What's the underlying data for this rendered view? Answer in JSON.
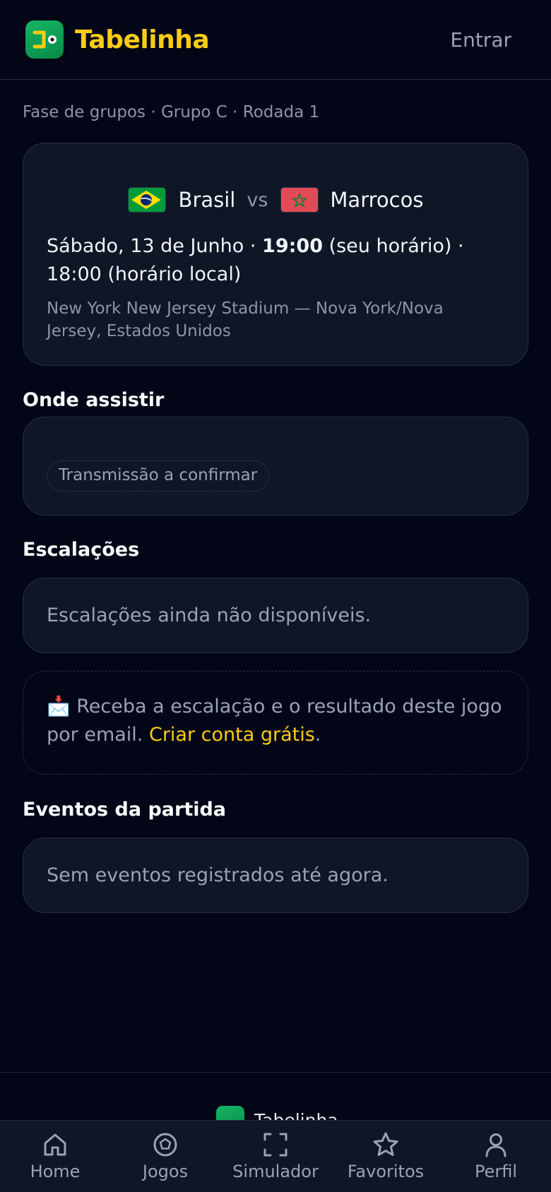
{
  "header": {
    "brand_name": "Tabelinha",
    "login_label": "Entrar"
  },
  "breadcrumb": "Fase de grupos · Grupo C · Rodada 1",
  "match": {
    "home_team": "Brasil",
    "away_team": "Marrocos",
    "vs_label": "vs",
    "date_prefix": "Sábado, 13 de Junho · ",
    "time_user": "19:00",
    "date_suffix": " (seu horário) · 18:00 (horário local)",
    "venue": "New York New Jersey Stadium — Nova York/Nova Jersey, Estados Unidos"
  },
  "where_to_watch": {
    "title": "Onde assistir",
    "status": "Transmissão a confirmar"
  },
  "lineups": {
    "title": "Escalações",
    "empty_text": "Escalações ainda não disponíveis."
  },
  "promo": {
    "emoji": "📩",
    "text": " Receba a escalação e o resultado deste jogo por email. ",
    "link_label": "Criar conta grátis",
    "end": "."
  },
  "events": {
    "title": "Eventos da partida",
    "empty_text": "Sem eventos registrados até agora."
  },
  "footer": {
    "brand_name": "Tabelinha"
  },
  "tabbar": {
    "items": [
      {
        "label": "Home",
        "icon": "home-icon"
      },
      {
        "label": "Jogos",
        "icon": "ball-icon"
      },
      {
        "label": "Simulador",
        "icon": "scan-frame-icon"
      },
      {
        "label": "Favoritos",
        "icon": "star-icon"
      },
      {
        "label": "Perfil",
        "icon": "user-icon"
      }
    ]
  },
  "colors": {
    "background": "#030617",
    "card": "#0f1626",
    "accent": "#facc15",
    "brand_green": "#0a9a4e",
    "muted": "#9aa3b2"
  }
}
